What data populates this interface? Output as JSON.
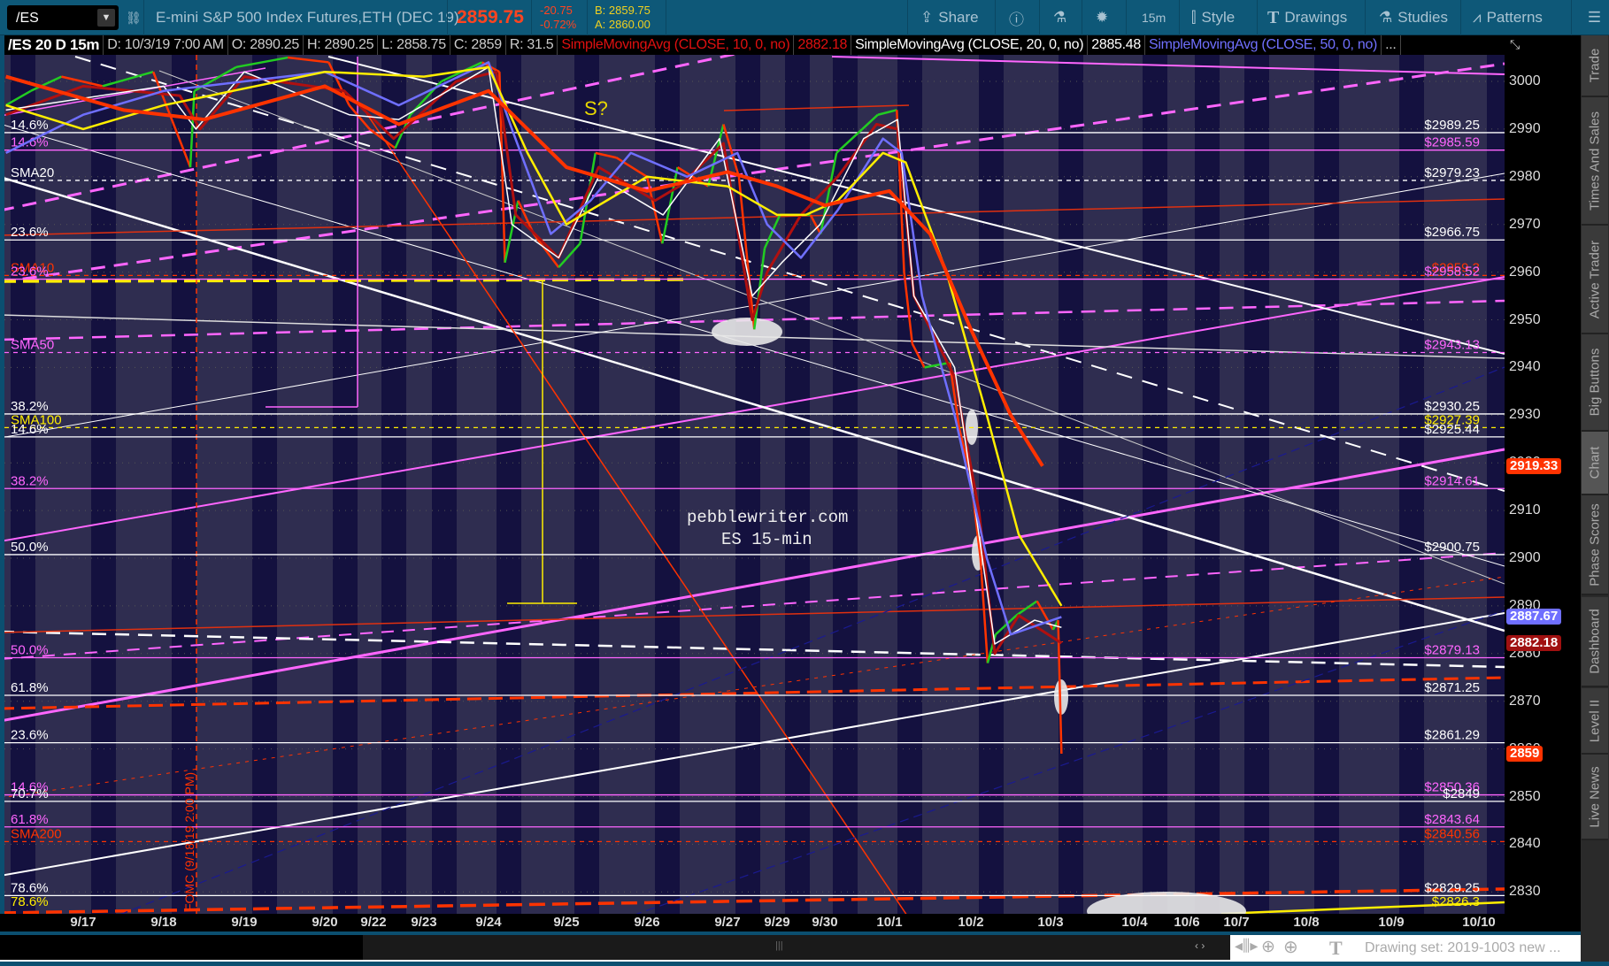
{
  "toolbar": {
    "symbol": "/ES",
    "description": "E-mini S&P 500 Index Futures,ETH (DEC 19)",
    "last": "2859.75",
    "change": "-20.75",
    "change_pct": "-0.72%",
    "bid": "B: 2859.75",
    "ask": "A: 2860.00",
    "share": "Share",
    "timeframe": "15m",
    "style": "Style",
    "drawings": "Drawings",
    "studies": "Studies",
    "patterns": "Patterns"
  },
  "header": {
    "chart_id": "/ES 20 D 15m",
    "date": "D: 10/3/19 7:00 AM",
    "open": "O: 2890.25",
    "high": "H: 2890.25",
    "low": "L: 2858.75",
    "close": "C: 2859",
    "range": "R: 31.5",
    "sma10_label": "SimpleMovingAvg (CLOSE, 10, 0, no)",
    "sma10_value": "2882.18",
    "sma20_label": "SimpleMovingAvg (CLOSE, 20, 0, no)",
    "sma20_value": "2885.48",
    "sma50_label": "SimpleMovingAvg (CLOSE, 50, 0, no)",
    "more": "..."
  },
  "side_tabs": [
    {
      "label": "Trade"
    },
    {
      "label": "Times And Sales"
    },
    {
      "label": "Active Trader"
    },
    {
      "label": "Big Buttons"
    },
    {
      "label": "Chart"
    },
    {
      "label": "Phase Scores"
    },
    {
      "label": "Dashboard"
    },
    {
      "label": "Level II"
    },
    {
      "label": "Live News"
    }
  ],
  "bottom": {
    "drawing_set": "Drawing set: 2019-1003 new ..."
  },
  "colors": {
    "white": "#ffffff",
    "magenta": "#ff66ff",
    "red": "#ff3300",
    "yellow": "#ffee00",
    "blue": "#6f6fff",
    "darkred": "#b01010"
  },
  "chart_data": {
    "type": "line",
    "title": "/ES 15m",
    "ylim": [
      2825,
      3005
    ],
    "yticks": [
      2830,
      2840,
      2850,
      2860,
      2870,
      2880,
      2890,
      2900,
      2910,
      2920,
      2930,
      2940,
      2950,
      2960,
      2970,
      2980,
      2990,
      3000
    ],
    "x_categories": [
      "9/17",
      "9/18",
      "9/19",
      "9/20",
      "9/22",
      "9/23",
      "9/24",
      "9/25",
      "9/26",
      "9/27",
      "9/29",
      "9/30",
      "10/1",
      "10/2",
      "10/3",
      "10/4",
      "10/6",
      "10/7",
      "10/8",
      "10/9",
      "10/10"
    ],
    "annotations": {
      "watermark1": "pebblewriter.com",
      "watermark2": "ES 15-min",
      "s_mark": "S?",
      "fomc": "FOMC (9/18/19 2:00 PM)"
    },
    "axis_badges": [
      {
        "value": "2919.33",
        "color": "#ff3300",
        "price": 2919.33
      },
      {
        "value": "2887.67",
        "color": "#6f6fff",
        "price": 2887.67
      },
      {
        "value": "2882.18",
        "color": "#a01010",
        "price": 2882.18
      },
      {
        "value": "2859",
        "color": "#ff3300",
        "price": 2859
      }
    ],
    "levels": [
      {
        "price": 2989.25,
        "left": "14.6%",
        "right": "$2989.25",
        "color": "#ffffff",
        "dash": false
      },
      {
        "price": 2985.59,
        "left": "14.6%",
        "right": "$2985.59",
        "color": "#ff66ff",
        "dash": false
      },
      {
        "price": 2979.23,
        "left": "SMA20",
        "right": "$2979.23",
        "color": "#ffffff",
        "dash": true
      },
      {
        "price": 2966.75,
        "left": "23.6%",
        "right": "$2966.75",
        "color": "#ffffff",
        "dash": false
      },
      {
        "price": 2959.3,
        "left": "SMA10",
        "right": "$2959.3",
        "color": "#ff3300",
        "dash": true
      },
      {
        "price": 2958.52,
        "left": "23.6%",
        "right": "$2958.52",
        "color": "#ff66ff",
        "dash": false
      },
      {
        "price": 2943.13,
        "left": "SMA50",
        "right": "$2943.13",
        "color": "#ff66ff",
        "dash": true
      },
      {
        "price": 2930.25,
        "left": "38.2%",
        "right": "$2930.25",
        "color": "#ffffff",
        "dash": false
      },
      {
        "price": 2927.39,
        "left": "SMA100",
        "right": "$2927.39",
        "color": "#ffee00",
        "dash": true
      },
      {
        "price": 2925.44,
        "left": "14.6%",
        "right": "$2925.44",
        "color": "#ffffff",
        "dash": false
      },
      {
        "price": 2914.61,
        "left": "38.2%",
        "right": "$2914.61",
        "color": "#ff66ff",
        "dash": false
      },
      {
        "price": 2900.75,
        "left": "50.0%",
        "right": "$2900.75",
        "color": "#ffffff",
        "dash": false
      },
      {
        "price": 2879.13,
        "left": "50.0%",
        "right": "$2879.13",
        "color": "#ff66ff",
        "dash": false
      },
      {
        "price": 2871.25,
        "left": "61.8%",
        "right": "$2871.25",
        "color": "#ffffff",
        "dash": false
      },
      {
        "price": 2861.29,
        "left": "23.6%",
        "right": "$2861.29",
        "color": "#ffffff",
        "dash": false
      },
      {
        "price": 2850.36,
        "left": "14.6%",
        "right": "$2850.36",
        "color": "#ff66ff",
        "dash": false
      },
      {
        "price": 2849,
        "left": "70.7%",
        "right": "$2849",
        "color": "#ffffff",
        "dash": false
      },
      {
        "price": 2843.64,
        "left": "61.8%",
        "right": "$2843.64",
        "color": "#ff66ff",
        "dash": false
      },
      {
        "price": 2840.56,
        "left": "SMA200",
        "right": "$2840.56",
        "color": "#ff3300",
        "dash": true
      },
      {
        "price": 2829.25,
        "left": "78.6%",
        "right": "$2829.25",
        "color": "#ffffff",
        "dash": false
      },
      {
        "price": 2826.3,
        "left": "78.6%",
        "right": "$2826.3",
        "color": "#ffee00",
        "dash": false,
        "noline": true
      }
    ],
    "series": [
      {
        "name": "price",
        "points": [
          [
            -0.96,
            2995
          ],
          [
            -0.65,
            2998
          ],
          [
            -0.27,
            3001
          ],
          [
            0.24,
            2999
          ],
          [
            0.87,
            3002
          ],
          [
            1.33,
            2982
          ],
          [
            1.38,
            2998
          ],
          [
            1.9,
            3003
          ],
          [
            2.54,
            3005
          ],
          [
            3.08,
            3004
          ],
          [
            3.5,
            2995
          ],
          [
            3.92,
            2990
          ],
          [
            4.43,
            2986
          ],
          [
            4.73,
            2993
          ],
          [
            5.27,
            3000
          ],
          [
            5.9,
            3004
          ],
          [
            6.14,
            3002
          ],
          [
            6.21,
            2962
          ],
          [
            6.38,
            2975
          ],
          [
            6.58,
            2968
          ],
          [
            6.9,
            2961
          ],
          [
            7.17,
            2966
          ],
          [
            7.36,
            2985
          ],
          [
            7.62,
            2984
          ],
          [
            8.0,
            2980
          ],
          [
            8.19,
            2966
          ],
          [
            8.38,
            2982
          ],
          [
            8.76,
            2978
          ],
          [
            8.95,
            2991
          ],
          [
            9.23,
            2980
          ],
          [
            9.54,
            2948
          ],
          [
            9.75,
            2965
          ],
          [
            10.06,
            2972
          ],
          [
            10.7,
            2972
          ],
          [
            10.91,
            2968
          ],
          [
            11.18,
            2985
          ],
          [
            11.58,
            2990
          ],
          [
            11.82,
            2993
          ],
          [
            12.09,
            2994
          ],
          [
            12.18,
            2960
          ],
          [
            12.28,
            2945
          ],
          [
            12.43,
            2940
          ],
          [
            12.74,
            2941
          ],
          [
            12.86,
            2927
          ],
          [
            12.99,
            2918
          ],
          [
            13.12,
            2900
          ],
          [
            13.21,
            2878
          ],
          [
            13.31,
            2884
          ],
          [
            13.57,
            2888
          ],
          [
            13.83,
            2891
          ],
          [
            14.03,
            2885
          ],
          [
            14.09,
            2887
          ],
          [
            14.13,
            2859
          ]
        ]
      },
      {
        "name": "SMA10",
        "color": "#b01010",
        "points": [
          [
            -0.96,
            2993
          ],
          [
            0,
            2999
          ],
          [
            1.2,
            2997
          ],
          [
            1.45,
            2990
          ],
          [
            2,
            3001
          ],
          [
            3.4,
            2998
          ],
          [
            4.4,
            2988
          ],
          [
            5.5,
            3000
          ],
          [
            6.1,
            3002
          ],
          [
            6.35,
            2972
          ],
          [
            6.9,
            2963
          ],
          [
            7.4,
            2982
          ],
          [
            8.1,
            2975
          ],
          [
            8.4,
            2978
          ],
          [
            8.95,
            2987
          ],
          [
            9.5,
            2950
          ],
          [
            9.8,
            2960
          ],
          [
            10.5,
            2972
          ],
          [
            11.2,
            2980
          ],
          [
            11.8,
            2991
          ],
          [
            12.1,
            2990
          ],
          [
            12.3,
            2955
          ],
          [
            12.8,
            2938
          ],
          [
            13.1,
            2910
          ],
          [
            13.3,
            2880
          ],
          [
            13.6,
            2888
          ],
          [
            14.13,
            2882.18
          ]
        ]
      },
      {
        "name": "SMA20",
        "color": "#ffffff",
        "points": [
          [
            -0.96,
            2994
          ],
          [
            1,
            2999
          ],
          [
            1.4,
            2990
          ],
          [
            2,
            3002
          ],
          [
            3.5,
            2993
          ],
          [
            4.5,
            2992
          ],
          [
            6,
            3003
          ],
          [
            6.3,
            2970
          ],
          [
            6.9,
            2963
          ],
          [
            7.4,
            2980
          ],
          [
            8.2,
            2972
          ],
          [
            8.9,
            2988
          ],
          [
            9.5,
            2955
          ],
          [
            10.1,
            2962
          ],
          [
            10.9,
            2970
          ],
          [
            11.6,
            2988
          ],
          [
            12.1,
            2992
          ],
          [
            12.3,
            2955
          ],
          [
            12.8,
            2940
          ],
          [
            13.1,
            2905
          ],
          [
            13.3,
            2882
          ],
          [
            13.8,
            2887
          ],
          [
            14.13,
            2885.48
          ]
        ]
      },
      {
        "name": "SMA50",
        "color": "#6f6fff",
        "points": [
          [
            -0.96,
            2985
          ],
          [
            0,
            2993
          ],
          [
            1,
            2998
          ],
          [
            3,
            3002
          ],
          [
            4.5,
            2995
          ],
          [
            6,
            3004
          ],
          [
            6.3,
            2990
          ],
          [
            6.8,
            2968
          ],
          [
            7.3,
            2975
          ],
          [
            7.8,
            2985
          ],
          [
            8.5,
            2980
          ],
          [
            9.2,
            2985
          ],
          [
            9.8,
            2970
          ],
          [
            10.5,
            2963
          ],
          [
            11.2,
            2973
          ],
          [
            11.9,
            2988
          ],
          [
            12.15,
            2985
          ],
          [
            12.4,
            2955
          ],
          [
            12.8,
            2930
          ],
          [
            13.2,
            2900
          ],
          [
            13.5,
            2884
          ],
          [
            14.13,
            2887.67
          ]
        ]
      },
      {
        "name": "SMA100",
        "color": "#ffee00",
        "points": [
          [
            -0.96,
            2995
          ],
          [
            0,
            2990
          ],
          [
            1,
            2995
          ],
          [
            3,
            3002
          ],
          [
            5,
            3001
          ],
          [
            6,
            3003
          ],
          [
            6.5,
            2985
          ],
          [
            7,
            2970
          ],
          [
            7.5,
            2975
          ],
          [
            8,
            2980
          ],
          [
            9,
            2978
          ],
          [
            10,
            2972
          ],
          [
            10.6,
            2972
          ],
          [
            11.2,
            2975
          ],
          [
            11.9,
            2985
          ],
          [
            12.2,
            2983
          ],
          [
            12.7,
            2960
          ],
          [
            13.2,
            2930
          ],
          [
            13.6,
            2905
          ],
          [
            14.13,
            2890
          ]
        ]
      },
      {
        "name": "SMA200",
        "color": "#ff3300",
        "points": [
          [
            -0.96,
            3001
          ],
          [
            0.5,
            2994
          ],
          [
            1.5,
            2992
          ],
          [
            3,
            2999
          ],
          [
            4.5,
            2991
          ],
          [
            6,
            2998
          ],
          [
            7,
            2982
          ],
          [
            8,
            2977
          ],
          [
            9,
            2981
          ],
          [
            10,
            2978
          ],
          [
            11,
            2974
          ],
          [
            12,
            2977
          ],
          [
            12.5,
            2968
          ],
          [
            13,
            2948
          ],
          [
            13.5,
            2930
          ],
          [
            13.9,
            2919.33
          ]
        ]
      }
    ]
  }
}
